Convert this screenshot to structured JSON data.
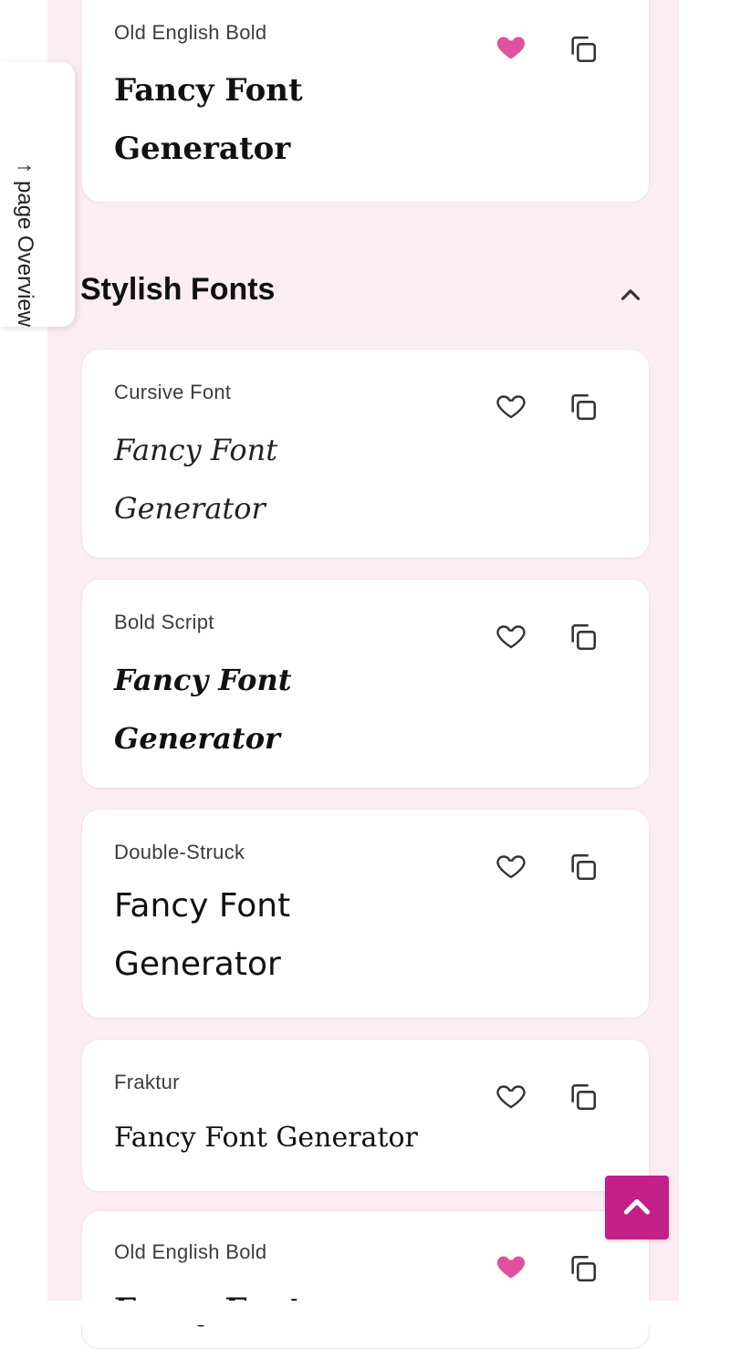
{
  "overview_tab": {
    "arrow": "↑",
    "label": "page Overview"
  },
  "section": {
    "title": "Stylish Fonts",
    "toggle_icon": "chevron-up-icon"
  },
  "colors": {
    "accent": "#c41e87",
    "heart_filled": "#e0509b",
    "panel_bg": "#fcedf3"
  },
  "cards": [
    {
      "label": "Old English Bold",
      "sample": "Fancy Font Generator",
      "favorited": true
    },
    {
      "label": "Cursive Font",
      "sample": "Fancy Font Generator",
      "favorited": false
    },
    {
      "label": "Bold Script",
      "sample": "Fancy Font Generator",
      "favorited": false
    },
    {
      "label": "Double-Struck",
      "sample": "Fancy Font Generator",
      "favorited": false
    },
    {
      "label": "Fraktur",
      "sample": "Fancy Font Generator",
      "favorited": false
    },
    {
      "label": "Old English Bold",
      "sample": "Fancy Font",
      "favorited": true
    }
  ],
  "scroll_top_icon": "chevron-up-icon"
}
